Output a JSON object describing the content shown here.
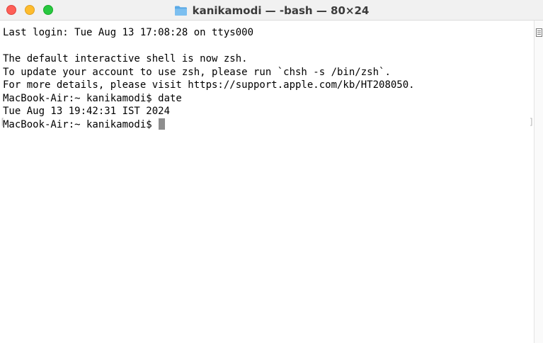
{
  "window": {
    "title": "kanikamodi — -bash — 80×24",
    "title_icon": "folder-icon",
    "controls": [
      "close",
      "minimize",
      "zoom"
    ],
    "accent": "#5aa9e6"
  },
  "terminal": {
    "lines": [
      "Last login: Tue Aug 13 17:08:28 on ttys000",
      "",
      "The default interactive shell is now zsh.",
      "To update your account to use zsh, please run `chsh -s /bin/zsh`.",
      "For more details, please visit https://support.apple.com/kb/HT208050.",
      "MacBook-Air:~ kanikamodi$ date",
      "Tue Aug 13 19:42:31 IST 2024"
    ],
    "prompt": "MacBook-Air:~ kanikamodi$ ",
    "mark_open": "[",
    "mark_close": "]"
  }
}
